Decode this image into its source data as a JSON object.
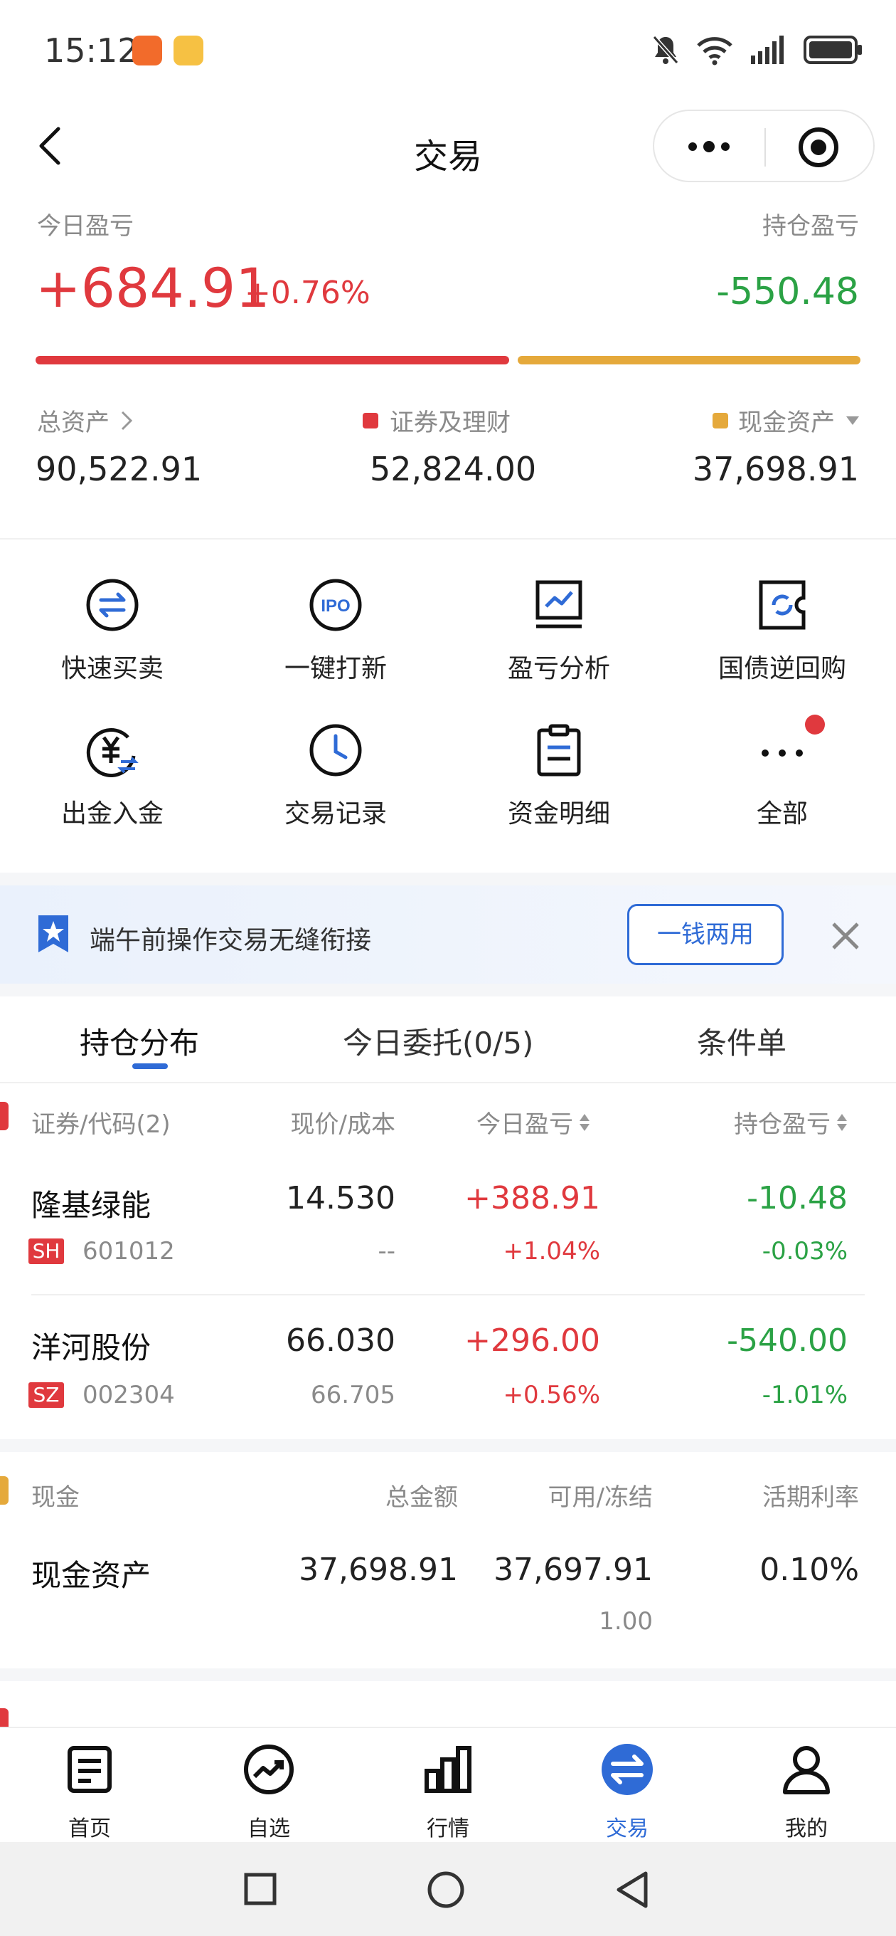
{
  "status_bar": {
    "time": "15:12"
  },
  "header": {
    "title": "交易"
  },
  "summary": {
    "today_pl_label": "今日盈亏",
    "today_pl_value": "+684.91",
    "today_pl_pct": "+0.76%",
    "holding_pl_label": "持仓盈亏",
    "holding_pl_value": "-550.48",
    "total_assets_label": "总资产",
    "total_assets_value": "90,522.91",
    "securities_label": "证券及理财",
    "securities_value": "52,824.00",
    "cash_label": "现金资产",
    "cash_value": "37,698.91"
  },
  "quick_actions": [
    {
      "label": "快速买卖",
      "icon": "swap-circle-icon"
    },
    {
      "label": "一键打新",
      "icon": "ipo-icon"
    },
    {
      "label": "盈亏分析",
      "icon": "chart-monitor-icon"
    },
    {
      "label": "国债逆回购",
      "icon": "refresh-ticket-icon"
    },
    {
      "label": "出金入金",
      "icon": "yuan-transfer-icon"
    },
    {
      "label": "交易记录",
      "icon": "clock-icon"
    },
    {
      "label": "资金明细",
      "icon": "clipboard-icon"
    },
    {
      "label": "全部",
      "icon": "more-dots-icon"
    }
  ],
  "banner": {
    "text": "端午前操作交易无缝衔接",
    "button": "一钱两用"
  },
  "tabs": [
    {
      "label": "持仓分布"
    },
    {
      "label": "今日委托(0/5)"
    },
    {
      "label": "条件单"
    }
  ],
  "positions": {
    "headers": {
      "name": "证券/代码(2)",
      "price": "现价/成本",
      "today": "今日盈亏",
      "holding": "持仓盈亏"
    },
    "rows": [
      {
        "name": "隆基绿能",
        "market": "SH",
        "code": "601012",
        "price": "14.530",
        "cost": "--",
        "today_pl": "+388.91",
        "today_pct": "+1.04%",
        "hold_pl": "-10.48",
        "hold_pct": "-0.03%"
      },
      {
        "name": "洋河股份",
        "market": "SZ",
        "code": "002304",
        "price": "66.030",
        "cost": "66.705",
        "today_pl": "+296.00",
        "today_pct": "+0.56%",
        "hold_pl": "-540.00",
        "hold_pct": "-1.01%"
      }
    ]
  },
  "cash": {
    "headers": {
      "name": "现金",
      "total": "总金额",
      "available": "可用/冻结",
      "rate": "活期利率"
    },
    "row": {
      "name": "现金资产",
      "total": "37,698.91",
      "available": "37,697.91",
      "frozen": "1.00",
      "rate": "0.10%"
    }
  },
  "bottom_nav": [
    {
      "label": "首页",
      "icon": "home-doc-icon"
    },
    {
      "label": "自选",
      "icon": "trend-circle-icon"
    },
    {
      "label": "行情",
      "icon": "bar-chart-icon"
    },
    {
      "label": "交易",
      "icon": "trade-swap-icon",
      "active": true
    },
    {
      "label": "我的",
      "icon": "user-icon"
    }
  ],
  "colors": {
    "up": "#e0393e",
    "down": "#2ba245",
    "accent": "#2f6bd6",
    "cash": "#e5a93b"
  }
}
